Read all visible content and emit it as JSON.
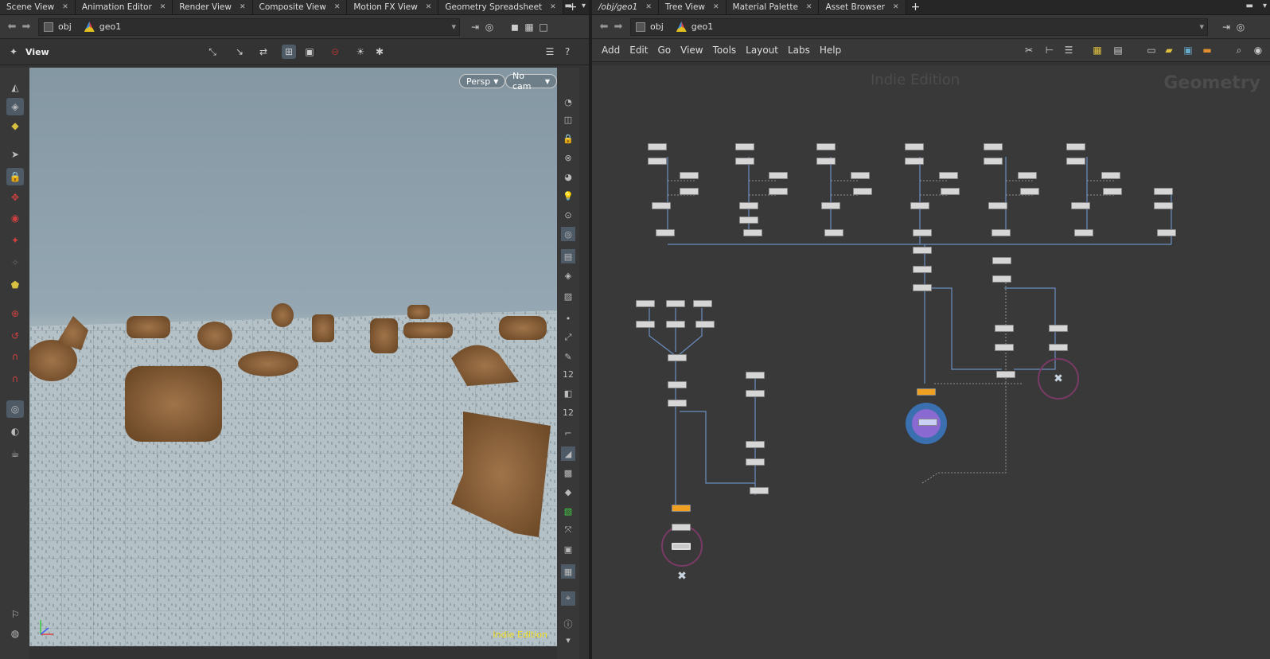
{
  "left": {
    "tabs": [
      "Scene View",
      "Animation Editor",
      "Render View",
      "Composite View",
      "Motion FX View",
      "Geometry Spreadsheet"
    ],
    "path": {
      "root": "obj",
      "node": "geo1"
    },
    "viewer": {
      "title": "View",
      "camera_mode": "Persp",
      "camera": "No cam",
      "watermark": "Indie Edition"
    }
  },
  "right": {
    "tabs": [
      "/obj/geo1",
      "Tree View",
      "Material Palette",
      "Asset Browser"
    ],
    "path": {
      "root": "obj",
      "node": "geo1"
    },
    "menu": [
      "Add",
      "Edit",
      "Go",
      "View",
      "Tools",
      "Layout",
      "Labs",
      "Help"
    ],
    "network": {
      "edition": "Indie Edition",
      "context": "Geometry"
    }
  },
  "icons": {
    "back": "back-arrow-icon",
    "forward": "forward-arrow-icon",
    "pin": "pin-icon",
    "help": "help-icon"
  },
  "colors": {
    "accent": "#4e5a66",
    "node": "#d6d6d6",
    "node_flag": "#f0a020",
    "output_ring": "#7a3a66",
    "display_ring": "#3a6fb0",
    "sky": "#8497a3",
    "ground": "#b8c4ca"
  }
}
